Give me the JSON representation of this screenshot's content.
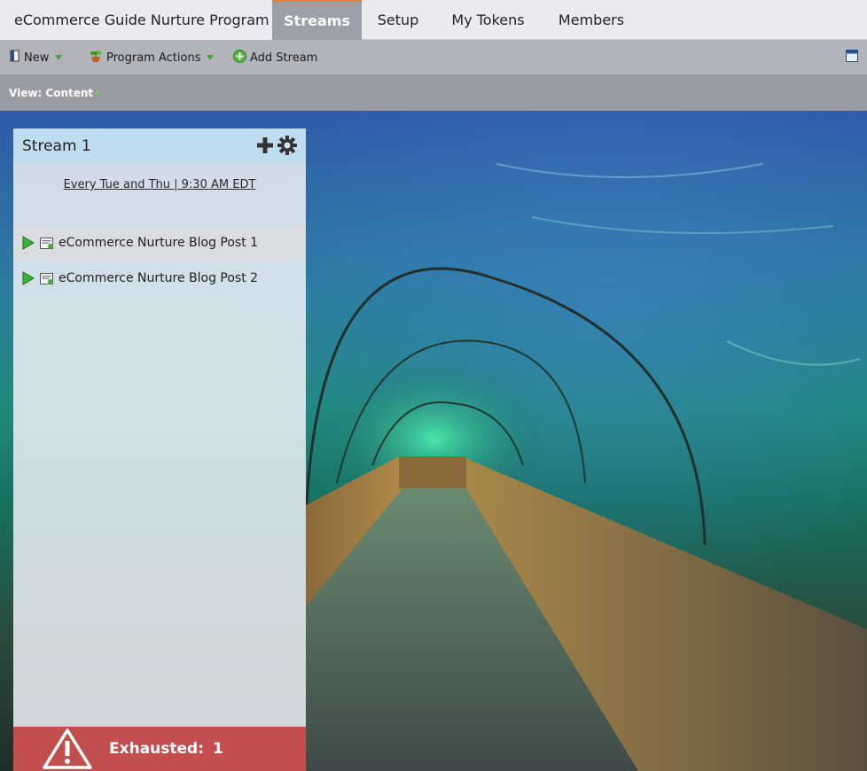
{
  "tabs": {
    "program_title": "eCommerce Guide Nurture Program",
    "items": [
      {
        "label": "Streams",
        "active": true
      },
      {
        "label": "Setup",
        "active": false
      },
      {
        "label": "My Tokens",
        "active": false
      },
      {
        "label": "Members",
        "active": false
      }
    ]
  },
  "toolbar": {
    "new_label": "New",
    "program_actions_label": "Program Actions",
    "add_stream_label": "Add Stream",
    "icons": [
      "new-document-icon",
      "plant-icon",
      "add-circle-icon",
      "window-icon"
    ]
  },
  "view": {
    "label": "View: Content"
  },
  "stream": {
    "title": "Stream 1",
    "cadence": "Every Tue and Thu | 9:30 AM EDT",
    "items": [
      {
        "label": "eCommerce Nurture Blog Post 1"
      },
      {
        "label": "eCommerce Nurture Blog Post 2"
      }
    ],
    "exhausted_label": "Exhausted:",
    "exhausted_count": "1"
  },
  "colors": {
    "active_tab": "#9c9fa7",
    "tab_accent": "#e2823c",
    "toolbar": "#b2b4ba",
    "viewbar": "#9a9ca2",
    "exhausted": "#c24e4e",
    "stream_header": "#bedcf0"
  }
}
